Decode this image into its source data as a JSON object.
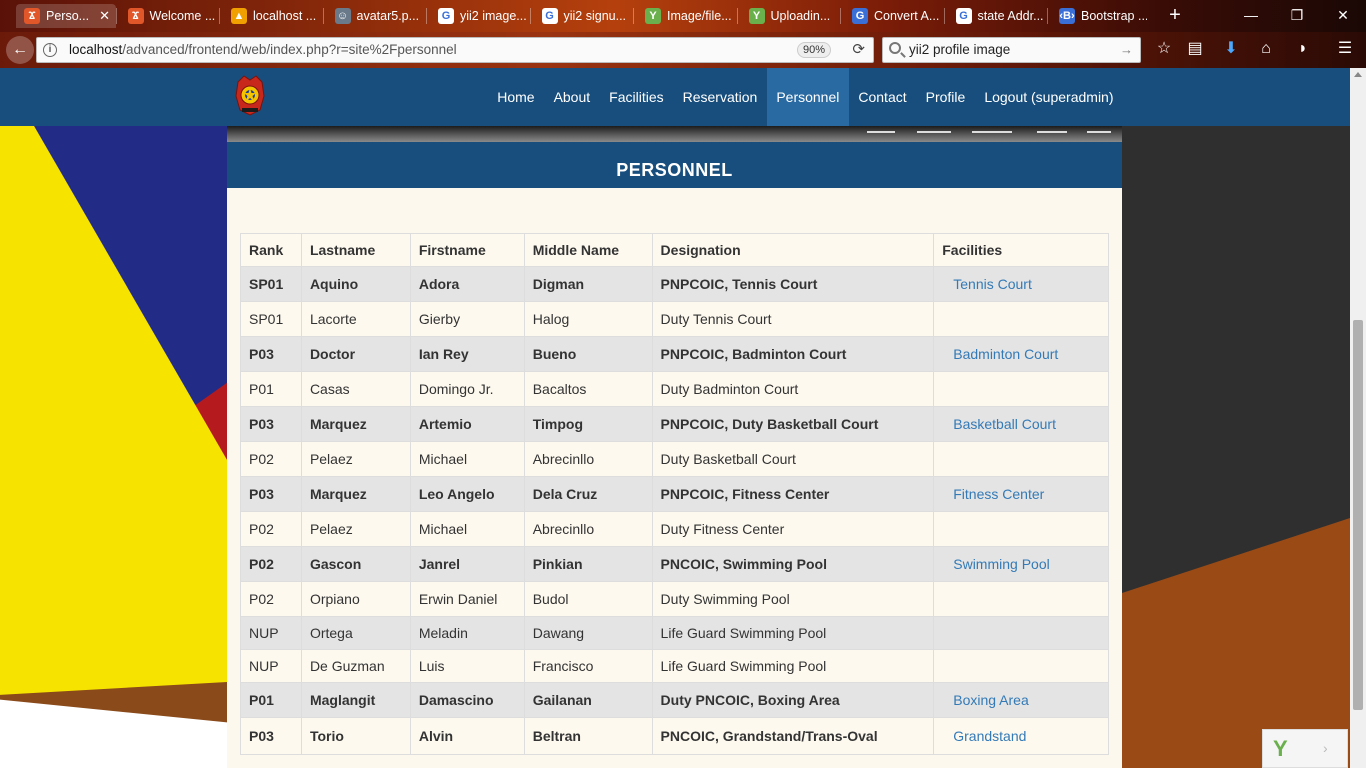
{
  "browser": {
    "tabs": [
      {
        "label": "Perso...",
        "icon_color": "#e2572a",
        "icon_glyph": "Ϫ"
      },
      {
        "label": "Welcome ...",
        "icon_color": "#e2572a",
        "icon_glyph": "Ϫ"
      },
      {
        "label": "localhost ...",
        "icon_color": "#f0a000",
        "icon_glyph": "▲"
      },
      {
        "label": "avatar5.p...",
        "icon_color": "#6a7a8a",
        "icon_glyph": "☺"
      },
      {
        "label": "yii2 image...",
        "icon_color": "#ffffff",
        "icon_glyph": "G"
      },
      {
        "label": "yii2 signu...",
        "icon_color": "#ffffff",
        "icon_glyph": "G"
      },
      {
        "label": "Image/file...",
        "icon_color": "#6ab04c",
        "icon_glyph": "Y"
      },
      {
        "label": "Uploadin...",
        "icon_color": "#6ab04c",
        "icon_glyph": "Y"
      },
      {
        "label": "Convert A...",
        "icon_color": "#3b6fd8",
        "icon_glyph": "G"
      },
      {
        "label": "state Addr...",
        "icon_color": "#ffffff",
        "icon_glyph": "G"
      },
      {
        "label": "Bootstrap ...",
        "icon_color": "#3b6fd8",
        "icon_glyph": "‹B›"
      }
    ],
    "url_prefix": "localhost",
    "url_rest": "/advanced/frontend/web/index.php?r=site%2Fpersonnel",
    "zoom": "90%",
    "search_value": "yii2 profile image"
  },
  "site": {
    "menu": [
      "Home",
      "About",
      "Facilities",
      "Reservation",
      "Personnel",
      "Contact",
      "Profile",
      "Logout (superadmin)"
    ],
    "active_menu": "Personnel",
    "page_title": "PERSONNEL",
    "brand_color": "#174e7d"
  },
  "table": {
    "headers": [
      "Rank",
      "Lastname",
      "Firstname",
      "Middle Name",
      "Designation",
      "Facilities"
    ],
    "rows": [
      [
        "SP01",
        "Aquino",
        "Adora",
        "Digman",
        "PNPCOIC, Tennis Court",
        "Tennis Court"
      ],
      [
        "SP01",
        "Lacorte",
        "Gierby",
        "Halog",
        "Duty Tennis Court",
        ""
      ],
      [
        "P03",
        "Doctor",
        "Ian Rey",
        "Bueno",
        "PNPCOIC, Badminton Court",
        "Badminton Court"
      ],
      [
        "P01",
        "Casas",
        "Domingo Jr.",
        "Bacaltos",
        "Duty Badminton Court",
        ""
      ],
      [
        "P03",
        "Marquez",
        "Artemio",
        "Timpog",
        "PNPCOIC, Duty Basketball Court",
        "Basketball Court"
      ],
      [
        "P02",
        "Pelaez",
        "Michael",
        "Abrecinllo",
        "Duty Basketball Court",
        ""
      ],
      [
        "P03",
        "Marquez",
        "Leo Angelo",
        "Dela Cruz",
        "PNPCOIC, Fitness Center",
        "Fitness Center"
      ],
      [
        "P02",
        "Pelaez",
        "Michael",
        "Abrecinllo",
        "Duty Fitness Center",
        ""
      ],
      [
        "P02",
        "Gascon",
        "Janrel",
        "Pinkian",
        "PNCOIC, Swimming Pool",
        "Swimming Pool"
      ],
      [
        "P02",
        "Orpiano",
        "Erwin Daniel",
        "Budol",
        "Duty Swimming Pool",
        ""
      ],
      [
        "NUP",
        "Ortega",
        "Meladin",
        "Dawang",
        "Life Guard Swimming Pool",
        ""
      ],
      [
        "NUP",
        "De Guzman",
        "Luis",
        "Francisco",
        "Life Guard Swimming Pool",
        ""
      ],
      [
        "P01",
        "Maglangit",
        "Damascino",
        "Gailanan",
        "Duty PNCOIC, Boxing Area",
        "Boxing Area"
      ],
      [
        "P03",
        "Torio",
        "Alvin",
        "Beltran",
        "PNCOIC, Grandstand/Trans-Oval",
        "Grandstand"
      ]
    ]
  }
}
